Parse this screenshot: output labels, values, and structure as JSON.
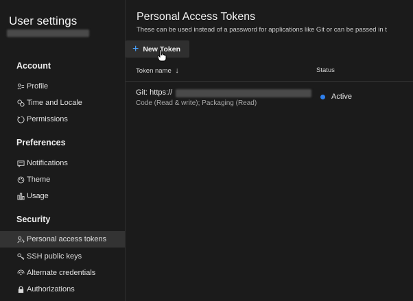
{
  "app_title": "User settings",
  "sidebar": {
    "sections": [
      {
        "title": "Account",
        "items": [
          {
            "label": "Profile",
            "icon": "profile-icon"
          },
          {
            "label": "Time and Locale",
            "icon": "time-locale-icon"
          },
          {
            "label": "Permissions",
            "icon": "permissions-icon"
          }
        ]
      },
      {
        "title": "Preferences",
        "items": [
          {
            "label": "Notifications",
            "icon": "notifications-icon"
          },
          {
            "label": "Theme",
            "icon": "theme-icon"
          },
          {
            "label": "Usage",
            "icon": "usage-icon"
          }
        ]
      },
      {
        "title": "Security",
        "items": [
          {
            "label": "Personal access tokens",
            "icon": "personal-access-tokens-icon"
          },
          {
            "label": "SSH public keys",
            "icon": "ssh-keys-icon"
          },
          {
            "label": "Alternate credentials",
            "icon": "alternate-credentials-icon"
          },
          {
            "label": "Authorizations",
            "icon": "authorizations-icon"
          }
        ]
      }
    ],
    "selected_item": "Personal access tokens"
  },
  "main": {
    "title": "Personal Access Tokens",
    "subtitle": "These can be used instead of a password for applications like Git or can be passed in t",
    "new_token_label": "New Token",
    "columns": {
      "token_name": "Token name",
      "status": "Status"
    },
    "tokens": [
      {
        "name": "Git: https://",
        "scopes": "Code (Read & write); Packaging (Read)",
        "status": "Active"
      }
    ]
  },
  "colors": {
    "accent": "#4aa3ff",
    "status_active": "#2f80ed",
    "background": "#1b1b1b"
  }
}
